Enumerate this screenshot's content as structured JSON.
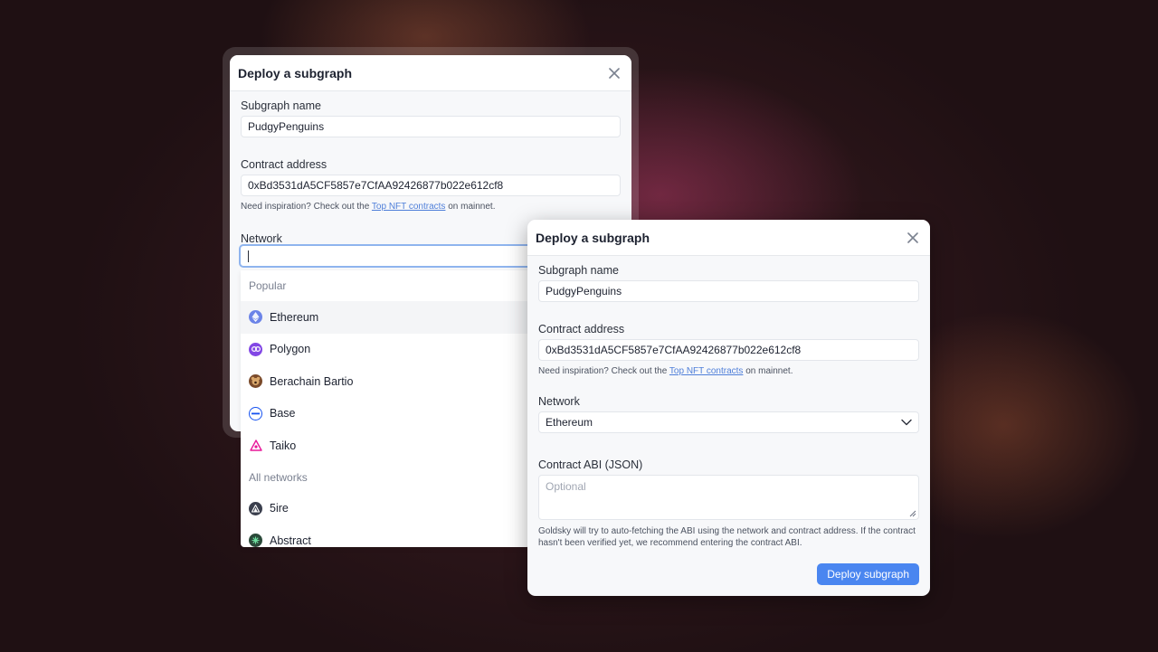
{
  "back_dialog": {
    "title": "Deploy a subgraph",
    "subgraph_name_label": "Subgraph name",
    "subgraph_name_value": "PudgyPenguins",
    "contract_address_label": "Contract address",
    "contract_address_value": "0xBd3531dA5CF5857e7CfAA92426877b022e612cf8",
    "hint_prefix": "Need inspiration? Check out the ",
    "hint_link": "Top NFT contracts",
    "hint_suffix": " on mainnet.",
    "network_label": "Network",
    "network_search_value": "",
    "popular_label": "Popular",
    "popular_networks": [
      {
        "name": "Ethereum",
        "icon": "ethereum-icon",
        "color": "#6c84e8"
      },
      {
        "name": "Polygon",
        "icon": "polygon-icon",
        "color": "#8247e5"
      },
      {
        "name": "Berachain Bartio",
        "icon": "berachain-icon",
        "color": "#7a4a2a"
      },
      {
        "name": "Base",
        "icon": "base-icon",
        "color": "#1652f0"
      },
      {
        "name": "Taiko",
        "icon": "taiko-icon",
        "color": "#e81899"
      }
    ],
    "all_networks_label": "All networks",
    "all_networks": [
      {
        "name": "5ire",
        "icon": "5ire-icon",
        "color": "#3a3f4d"
      },
      {
        "name": "Abstract",
        "icon": "abstract-icon",
        "color": "#2b4a3a"
      }
    ]
  },
  "front_dialog": {
    "title": "Deploy a subgraph",
    "subgraph_name_label": "Subgraph name",
    "subgraph_name_value": "PudgyPenguins",
    "contract_address_label": "Contract address",
    "contract_address_value": "0xBd3531dA5CF5857e7CfAA92426877b022e612cf8",
    "hint_prefix": "Need inspiration? Check out the ",
    "hint_link": "Top NFT contracts",
    "hint_suffix": " on mainnet.",
    "network_label": "Network",
    "network_value": "Ethereum",
    "abi_label": "Contract ABI (JSON)",
    "abi_placeholder": "Optional",
    "abi_hint": "Goldsky will try to auto-fetching the ABI using the network and contract address. If the contract hasn't been verified yet, we recommend entering the contract ABI.",
    "deploy_button": "Deploy subgraph"
  },
  "colors": {
    "accent": "#4a86f0",
    "link": "#4f7fd9",
    "focus_ring": "#8fb4ee"
  }
}
